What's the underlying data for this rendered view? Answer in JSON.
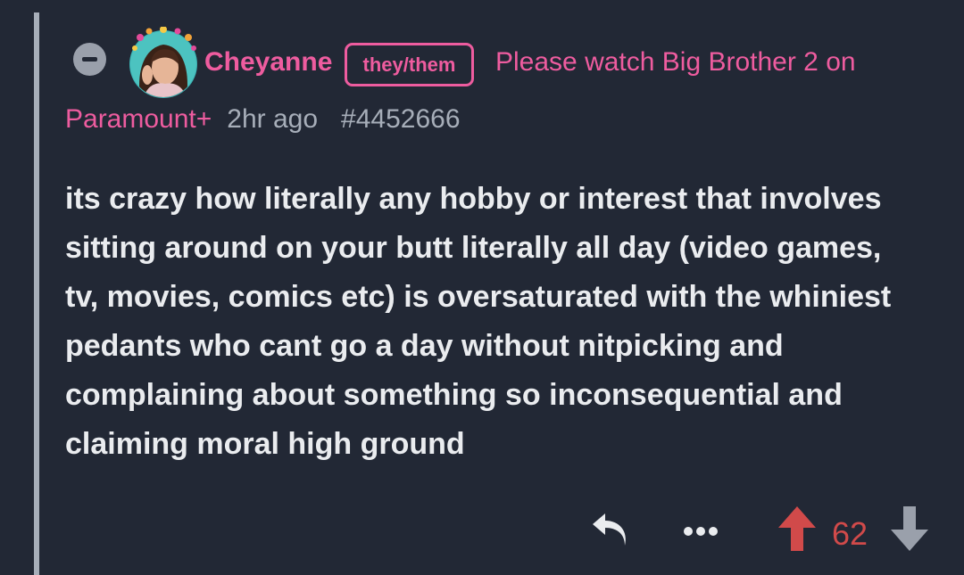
{
  "comment": {
    "author": "Cheyanne",
    "pronouns": "they/them",
    "flair_line1": "Please watch Big Brother 2 on",
    "flair_line2": "Paramount+",
    "time": "2hr ago",
    "id": "#4452666",
    "body": "its crazy how literally any hobby or interest that involves sitting around on your butt literally all day (video games, tv, movies, comics etc) is oversaturated with the whiniest pedants who cant go a day without nitpicking and complaining about something so inconsequential and claiming moral high ground",
    "score": "62"
  },
  "colors": {
    "background": "#222835",
    "accent": "#ee5c9f",
    "muted": "#a7aeb9",
    "text": "#eaecef",
    "upvote": "#d14a4a",
    "downvote": "#9aa0ab"
  },
  "icons": {
    "collapse": "minus-circle-icon",
    "reply": "reply-arrow-icon",
    "more": "ellipsis-icon",
    "upvote": "upvote-arrow-icon",
    "downvote": "downvote-arrow-icon"
  }
}
